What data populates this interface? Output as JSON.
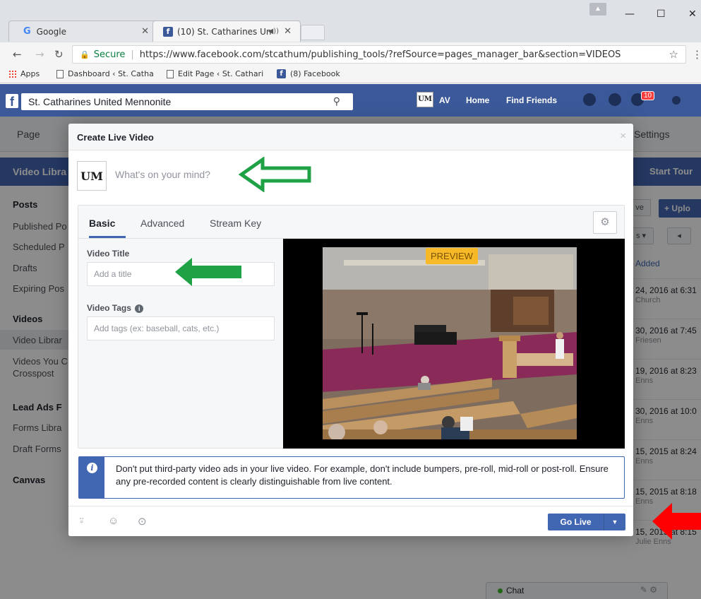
{
  "browser": {
    "tabs": [
      {
        "label": "Google",
        "favicon": "google-g-icon"
      },
      {
        "label": "(10) St. Catharines Un",
        "favicon": "facebook-f-icon"
      }
    ],
    "address": {
      "secure_label": "Secure",
      "url": "https://www.facebook.com/stcathum/publishing_tools/?refSource=pages_manager_bar&section=VIDEOS"
    },
    "bookmarks": [
      {
        "label": "Apps"
      },
      {
        "label": "Dashboard ‹ St. Catha"
      },
      {
        "label": "Edit Page ‹ St. Cathari"
      },
      {
        "label": "(8) Facebook"
      }
    ]
  },
  "facebook": {
    "search_value": "St. Catharines United Mennonite",
    "page_icon_text": "UM",
    "nav": {
      "profile": "AV",
      "home": "Home",
      "find_friends": "Find Friends",
      "notifications_count": "10"
    },
    "page_tabs": {
      "page": "Page",
      "settings": "Settings"
    },
    "video_library_header": "Video Libra",
    "start_tour": "Start Tour",
    "sidebar": {
      "posts_head": "Posts",
      "posts_items": [
        "Published Po",
        "Scheduled P",
        "Drafts",
        "Expiring Pos"
      ],
      "videos_head": "Videos",
      "videos_items": [
        "Video Librar",
        "Videos You C",
        "Crosspost"
      ],
      "lead_head": "Lead Ads F",
      "lead_items": [
        "Forms Libra",
        "Draft Forms"
      ],
      "canvas_head": "Canvas"
    },
    "right_list": {
      "upload_label": "+ Uplo",
      "added_header": "Added",
      "rows": [
        {
          "date": "24, 2016 at 6:31",
          "name": "Church"
        },
        {
          "date": "30, 2016 at 7:45",
          "name": "Friesen"
        },
        {
          "date": "19, 2016 at 8:23",
          "name": "Enns"
        },
        {
          "date": "30, 2016 at 10:0",
          "name": "Enns"
        },
        {
          "date": "15, 2015 at 8:24",
          "name": "Enns"
        },
        {
          "date": "15, 2015 at 8:18",
          "name": "Enns"
        },
        {
          "date": "15, 2015 at 8:15",
          "name": "Julie Enns"
        }
      ]
    },
    "chat_label": "Chat"
  },
  "modal": {
    "title": "Create Live Video",
    "avatar_text": "UM",
    "composer_placeholder": "What's on your mind?",
    "tabs": [
      {
        "label": "Basic",
        "active": true
      },
      {
        "label": "Advanced",
        "active": false
      },
      {
        "label": "Stream Key",
        "active": false
      }
    ],
    "video_title_label": "Video Title",
    "video_title_placeholder": "Add a title",
    "video_tags_label": "Video Tags",
    "video_tags_placeholder": "Add tags (ex: baseball, cats, etc.)",
    "preview_label": "PREVIEW",
    "notice_text": "Don't put third-party video ads in your live video. For example, don't include bumpers, pre-roll, mid-roll or post-roll. Ensure any pre-recorded content is clearly distinguishable from live content.",
    "go_live_label": "Go Live"
  },
  "annotations": {
    "green_arrow_color": "#1fa146",
    "red_arrow_color": "#ff0000"
  }
}
